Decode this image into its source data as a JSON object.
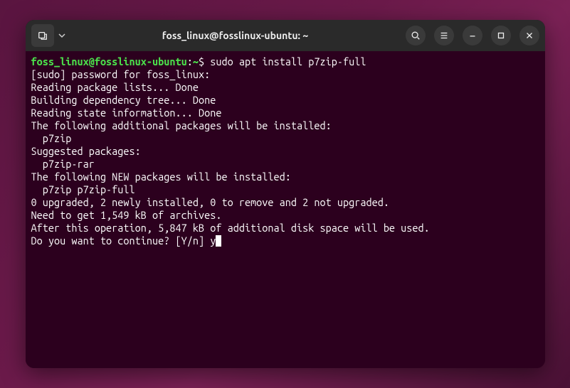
{
  "window": {
    "title": "foss_linux@fosslinux-ubuntu: ~"
  },
  "prompt": {
    "user_host": "foss_linux@fosslinux-ubuntu",
    "separator": ":",
    "path": "~",
    "symbol": "$",
    "command": "sudo apt install p7zip-full"
  },
  "output": {
    "line1": "[sudo] password for foss_linux:",
    "line2": "Reading package lists... Done",
    "line3": "Building dependency tree... Done",
    "line4": "Reading state information... Done",
    "line5": "The following additional packages will be installed:",
    "line6": "  p7zip",
    "line7": "Suggested packages:",
    "line8": "  p7zip-rar",
    "line9": "The following NEW packages will be installed:",
    "line10": "  p7zip p7zip-full",
    "line11": "0 upgraded, 2 newly installed, 0 to remove and 2 not upgraded.",
    "line12": "Need to get 1,549 kB of archives.",
    "line13": "After this operation, 5,847 kB of additional disk space will be used.",
    "line14": "Do you want to continue? [Y/n] ",
    "input": "y"
  }
}
